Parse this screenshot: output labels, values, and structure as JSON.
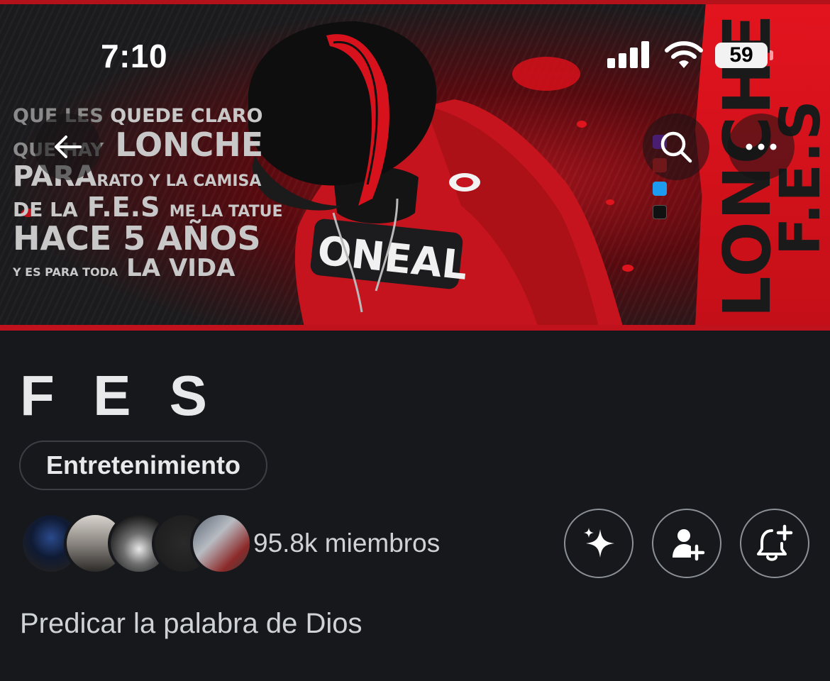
{
  "status_bar": {
    "time": "7:10",
    "battery": "59"
  },
  "banner": {
    "left_text": {
      "l1a": "QUE LES",
      "l1b": "QUEDE CLARO",
      "l2a": "QUE HAY",
      "l2b": "LONCHE",
      "l3a": "PARA",
      "l3b": "RATO Y LA CAMISA",
      "l4a": "DE LA",
      "l4b": "F.E.S",
      "l4c": "ME LA TATUE",
      "l5": "HACE 5 AÑOS",
      "l6a": "Y ES PARA TODA",
      "l6b": "LA VIDA"
    },
    "strip_text_big": "LONCHE",
    "strip_text_small": "F.E.S",
    "shirt_text": "ONEAL",
    "accent_color": "#d0121c"
  },
  "header_icons": {
    "back": "arrow-left-icon",
    "search": "search-icon",
    "more": "more-horizontal-icon"
  },
  "community": {
    "name": "F E S",
    "category": "Entretenimiento",
    "members_label": "95.8k miembros",
    "description": "Predicar la palabra de Dios"
  },
  "actions": [
    {
      "name": "sparkle-icon"
    },
    {
      "name": "add-user-icon"
    },
    {
      "name": "bell-plus-icon"
    }
  ],
  "colors": {
    "background": "#16181c",
    "text_primary": "#e7e9ea",
    "text_secondary": "#cfd3d6",
    "border": "#3b3f44"
  }
}
